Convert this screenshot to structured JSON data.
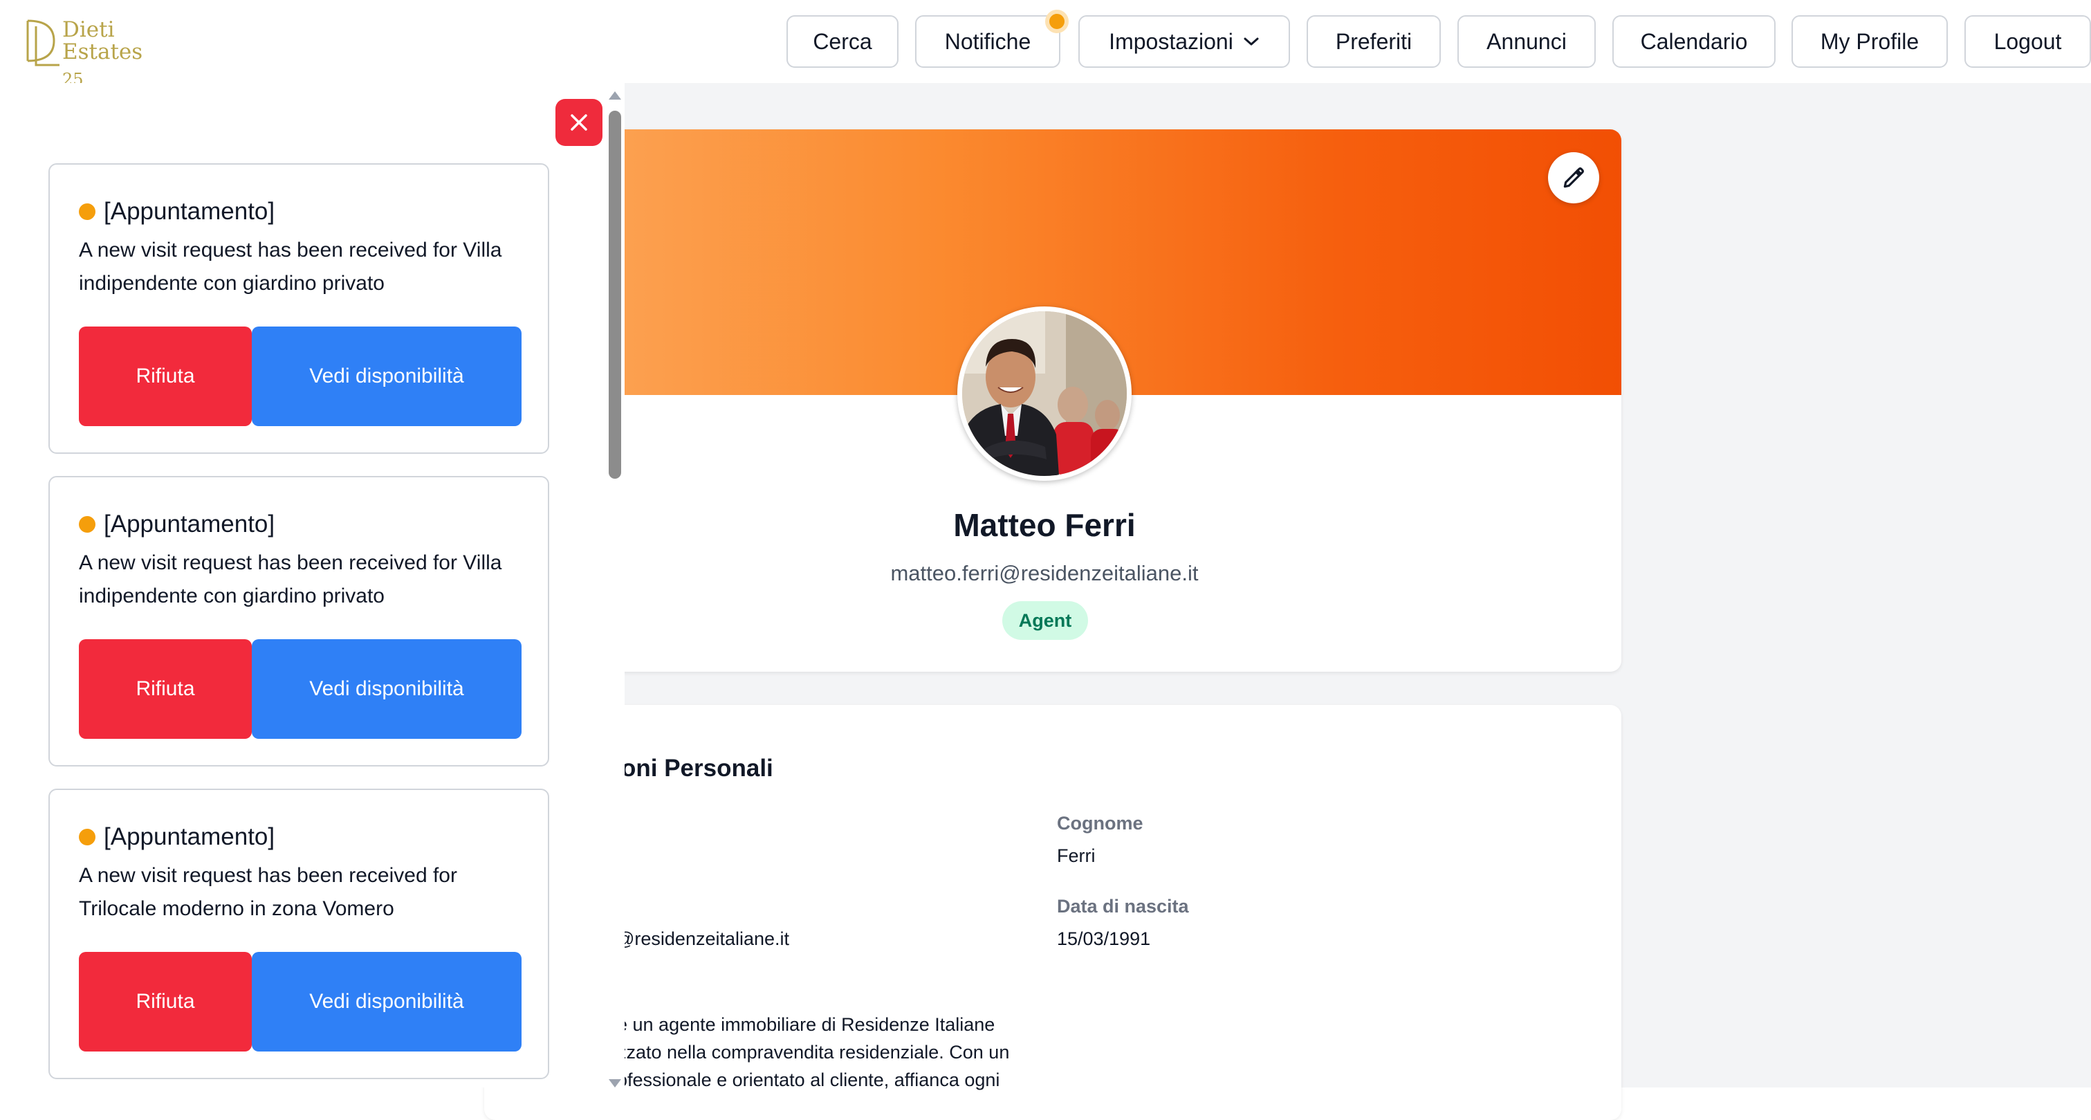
{
  "header": {
    "logo_line1": "Dieti",
    "logo_line2": "Estates",
    "logo_suffix": "25",
    "nav": [
      {
        "label": "Cerca"
      },
      {
        "label": "Notifiche"
      },
      {
        "label": "Impostazioni"
      },
      {
        "label": "Preferiti"
      },
      {
        "label": "Annunci"
      },
      {
        "label": "Calendario"
      },
      {
        "label": "My Profile"
      },
      {
        "label": "Logout"
      }
    ]
  },
  "profile": {
    "name": "Matteo Ferri",
    "email": "matteo.ferri@residenzeitaliane.it",
    "role": "Agent"
  },
  "personal_info": {
    "title": "oni Personali",
    "cognome_label": "Cognome",
    "cognome_value": "Ferri",
    "email_value": "@residenzeitaliane.it",
    "birth_label": "Data di nascita",
    "birth_value": "15/03/1991",
    "bio_line1": "è un agente immobiliare di Residenze Italiane",
    "bio_line2": "zzato nella compravendita residenziale. Con un",
    "bio_line3": "ofessionale e orientato al cliente, affianca ogni"
  },
  "notifications": {
    "items": [
      {
        "type": "[Appuntamento]",
        "message": "A new visit request has been received for Villa indipendente con giardino privato",
        "reject_label": "Rifiuta",
        "view_label": "Vedi disponibilità"
      },
      {
        "type": "[Appuntamento]",
        "message": "A new visit request has been received for Villa indipendente con giardino privato",
        "reject_label": "Rifiuta",
        "view_label": "Vedi disponibilità"
      },
      {
        "type": "[Appuntamento]",
        "message": "A new visit request has been received for Trilocale moderno in zona Vomero",
        "reject_label": "Rifiuta",
        "view_label": "Vedi disponibilità"
      }
    ]
  },
  "colors": {
    "accent_orange": "#f59e0b",
    "reject_red": "#f22a3c",
    "view_blue": "#2f80f6",
    "agent_badge_bg": "#d1fae5",
    "agent_badge_text": "#047857",
    "logo_gold": "#b8a44a"
  },
  "icons": {
    "close": "close-icon",
    "edit": "pencil-icon",
    "dropdown": "chevron-down-icon"
  }
}
